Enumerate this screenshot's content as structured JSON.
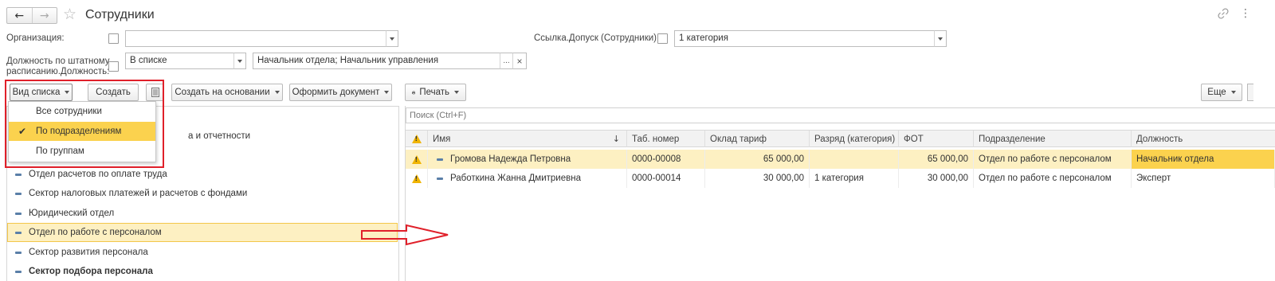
{
  "window": {
    "title": "Сотрудники",
    "star_glyph": "☆",
    "link_glyph": "🔗",
    "more_glyph": "⋮"
  },
  "filters": {
    "organization_label": "Организация:",
    "organization_value": "",
    "access_label": "Ссылка.Допуск (Сотрудники):",
    "access_value": "1 категория",
    "position_label_line1": "Должность по штатному",
    "position_label_line2": "расписанию.Должность:",
    "position_condition": "В списке",
    "position_value": "Начальник отдела; Начальник управления",
    "ellipsis": "...",
    "clear": "×"
  },
  "toolbar": {
    "view_list": "Вид списка",
    "create": "Создать",
    "create_based_on": "Создать на основании",
    "make_document": "Оформить документ",
    "print": "Печать",
    "more": "Еще"
  },
  "view_menu": {
    "items": [
      {
        "label": "Все сотрудники",
        "checked": false
      },
      {
        "label": "По подразделениям",
        "checked": true
      },
      {
        "label": "По группам",
        "checked": false
      }
    ]
  },
  "tree": {
    "partial_item": "а и отчетности",
    "items": [
      {
        "label": "Отдел расчетов по оплате труда",
        "selected": false,
        "bold": false
      },
      {
        "label": "Сектор налоговых платежей и расчетов с фондами",
        "selected": false,
        "bold": false
      },
      {
        "label": "Юридический отдел",
        "selected": false,
        "bold": false
      },
      {
        "label": "Отдел по работе с персоналом",
        "selected": true,
        "bold": false
      },
      {
        "label": "Сектор развития персонала",
        "selected": false,
        "bold": false
      },
      {
        "label": "Сектор подбора персонала",
        "selected": false,
        "bold": true
      }
    ]
  },
  "search": {
    "placeholder": "Поиск (Ctrl+F)"
  },
  "grid": {
    "columns": [
      "Имя",
      "Таб. номер",
      "Оклад тариф",
      "Разряд (категория)",
      "ФОТ",
      "Подразделение",
      "Должность"
    ],
    "sort_arrow": "↓",
    "rows": [
      {
        "name": "Громова Надежда Петровна",
        "tab": "0000-00008",
        "salary": "65 000,00",
        "grade": "",
        "fot": "65 000,00",
        "dept": "Отдел по работе с персоналом",
        "position": "Начальник отдела"
      },
      {
        "name": "Работкина Жанна Дмитриевна",
        "tab": "0000-00014",
        "salary": "30 000,00",
        "grade": "1 категория",
        "fot": "30 000,00",
        "dept": "Отдел по работе с персоналом",
        "position": "Эксперт"
      }
    ]
  },
  "colors": {
    "highlight_red": "#e0202a",
    "selected_row": "#fdf0c2",
    "selected_cell": "#fbd24e",
    "menu_checked": "#fbd24e"
  }
}
